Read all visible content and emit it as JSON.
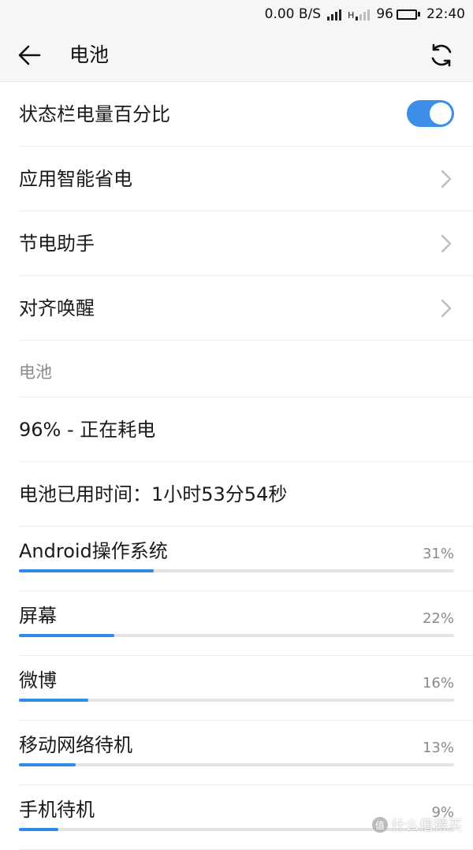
{
  "status_bar": {
    "net_speed": "0.00 B/S",
    "network_type": "H",
    "battery_level": "96",
    "battery_fill_percent": 96,
    "time": "22:40",
    "icons": [
      "signal-icon",
      "signal-icon",
      "battery-icon"
    ]
  },
  "app_bar": {
    "title": "电池",
    "back_icon": "back-arrow-icon",
    "refresh_icon": "refresh-icon"
  },
  "settings": [
    {
      "label": "状态栏电量百分比",
      "control": "toggle",
      "enabled": true
    },
    {
      "label": "应用智能省电",
      "control": "chevron"
    },
    {
      "label": "节电助手",
      "control": "chevron"
    },
    {
      "label": "对齐唤醒",
      "control": "chevron"
    }
  ],
  "battery_section": {
    "header": "电池",
    "status": "96% - 正在耗电",
    "usage_time": "电池已用时间：1小时53分54秒"
  },
  "usage": [
    {
      "name": "Android操作系统",
      "percent": "31%",
      "value": 31
    },
    {
      "name": "屏幕",
      "percent": "22%",
      "value": 22
    },
    {
      "name": "微博",
      "percent": "16%",
      "value": 16
    },
    {
      "name": "移动网络待机",
      "percent": "13%",
      "value": 13
    },
    {
      "name": "手机待机",
      "percent": "9%",
      "value": 9
    }
  ],
  "watermark": {
    "badge": "值",
    "text": "什么值得买"
  },
  "colors": {
    "accent": "#3d8ee8",
    "bar": "#2f8be6",
    "secondary_text": "#8a8a8a"
  }
}
